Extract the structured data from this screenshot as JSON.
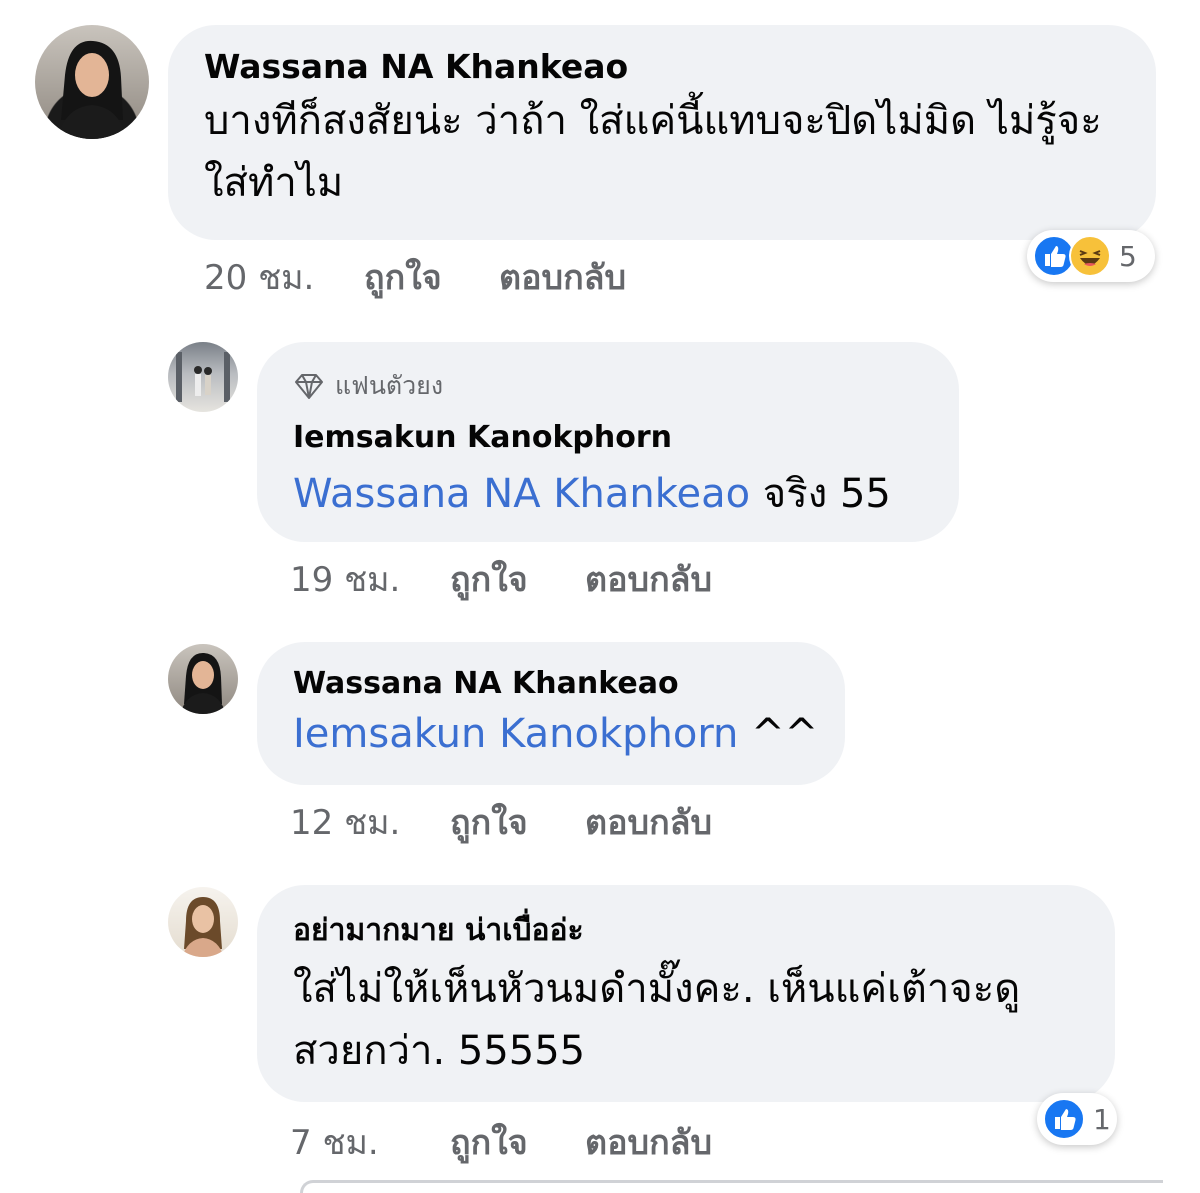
{
  "comments": [
    {
      "author": "Wassana NA Khankeao",
      "text": "บางทีก็สงสัยน่ะ ว่าถ้า ใส่แค่นี้แทบจะปิดไม่มิด ไม่รู้จะใส่ทำไม",
      "time": "20 ชม.",
      "like_label": "ถูกใจ",
      "reply_label": "ตอบกลับ",
      "reaction_icons": [
        "like-icon",
        "haha-icon"
      ],
      "reaction_count": "5"
    },
    {
      "badge": "แฟนตัวยง",
      "badge_icon": "diamond-icon",
      "author": "Iemsakun Kanokphorn",
      "mention": "Wassana NA Khankeao",
      "text": " จริง 55",
      "time": "19 ชม.",
      "like_label": "ถูกใจ",
      "reply_label": "ตอบกลับ"
    },
    {
      "author": "Wassana NA Khankeao",
      "mention": "Iemsakun Kanokphorn",
      "text": " ^^",
      "time": "12 ชม.",
      "like_label": "ถูกใจ",
      "reply_label": "ตอบกลับ"
    },
    {
      "author": "อย่ามากมาย น่าเบื่ออ่ะ",
      "text": "ใส่ไม่ให้เห็นหัวนมดำมั๊งคะ. เห็นแค่เต้าจะดูสวยกว่า. 55555",
      "time": "7 ชม.",
      "like_label": "ถูกใจ",
      "reply_label": "ตอบกลับ",
      "reaction_icons": [
        "like-icon"
      ],
      "reaction_count": "1"
    }
  ],
  "colors": {
    "bubble": "#f0f2f5",
    "mention": "#3b6fd1",
    "meta": "#65676b",
    "like_blue": "#1877f2",
    "haha_yellow": "#f7c13a"
  }
}
